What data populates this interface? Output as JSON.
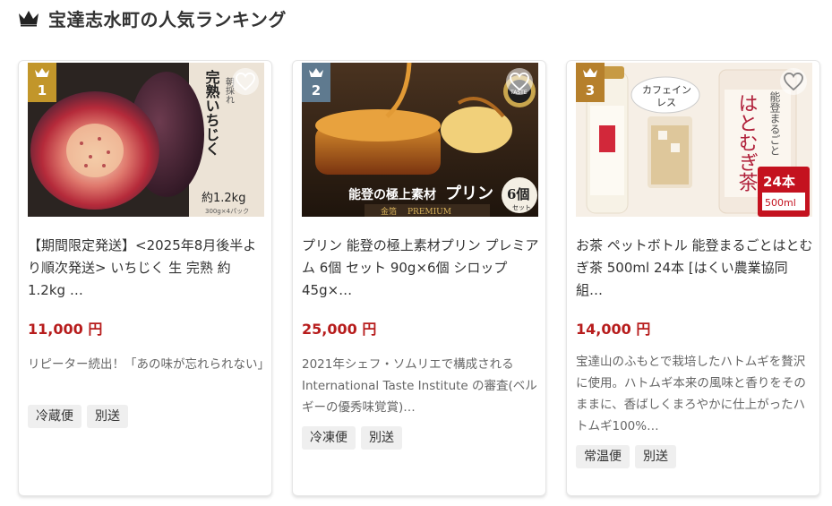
{
  "header": {
    "title": "宝達志水町の人気ランキング",
    "icon": "crown-icon"
  },
  "items": [
    {
      "rank": "1",
      "title": "【期間限定発送】<2025年8月後半より順次発送> いちじく 生 完熟 約1.2kg …",
      "price": "11,000 円",
      "description": "リピーター続出！「あの味が忘れられない」",
      "tags": [
        "冷蔵便",
        "別送"
      ],
      "image_text": {
        "vertical_1": "朝採れ",
        "vertical_2": "完熟いちじく",
        "weight": "約1.2kg",
        "pack": "300g×4パック"
      }
    },
    {
      "rank": "2",
      "title": "プリン 能登の極上素材プリン プレミアム 6個 セット 90g×6個 シロップ 45g×…",
      "price": "25,000 円",
      "description": "2021年シェフ・ソムリエで構成される International Taste Institute の審査(ベルギーの優秀味覚賞)…",
      "tags": [
        "冷凍便",
        "別送"
      ],
      "image_text": {
        "headline_1": "能登の極上素材",
        "headline_2": "プリン",
        "sub_1": "金箔",
        "sub_2": "PREMIUM",
        "count": "6個",
        "count_sub": "セット",
        "award": "TASTE"
      }
    },
    {
      "rank": "3",
      "title": "お茶 ペットボトル 能登まるごとはとむぎ茶 500ml 24本 [はくい農業協同組…",
      "price": "14,000 円",
      "description": "宝達山のふもとで栽培したハトムギを贅沢に使用。ハトムギ本来の風味と香りをそのままに、香ばしくまろやかに仕上がったハトムギ100%…",
      "tags": [
        "常温便",
        "別送"
      ],
      "image_text": {
        "bubble_1": "カフェイン",
        "bubble_2": "レス",
        "vertical": "はとむぎ茶",
        "brand": "能登まるごと",
        "count": "24本",
        "volume": "500ml"
      }
    }
  ],
  "colors": {
    "price": "#b71c1c",
    "rank_1": "#c2962a",
    "rank_2": "#5f7a8f",
    "rank_3": "#b6802c"
  }
}
